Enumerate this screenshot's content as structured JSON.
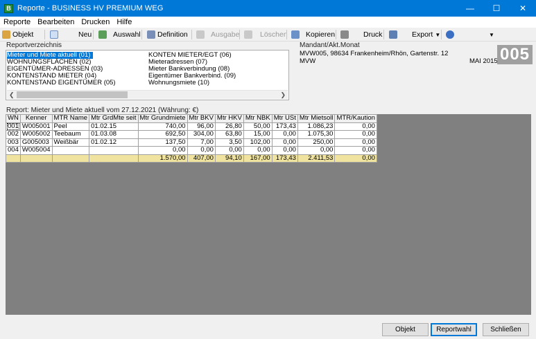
{
  "window": {
    "title": "Reporte - BUSINESS HV PREMIUM WEG",
    "app_icon_letter": "B",
    "controls": [
      "minimize-icon",
      "maximize-icon",
      "close-icon"
    ]
  },
  "menu": [
    "Reporte",
    "Bearbeiten",
    "Drucken",
    "Hilfe"
  ],
  "toolbar": {
    "objekt": "Objekt",
    "neu": "Neu",
    "auswahl": "Auswahl",
    "definition": "Definition",
    "ausgabe": "Ausgabe",
    "loeschen": "Löschen",
    "kopieren": "Kopieren",
    "druck": "Druck",
    "export": "Export"
  },
  "reportverzeichnis": {
    "label": "Reportverzeichnis",
    "left_items": [
      "Mieter und Miete aktuell (01)",
      "WOHNUNGSFLÄCHEN (02)",
      "EIGENTÜMER-ADRESSEN (03)",
      "KONTENSTAND MIETER (04)",
      "KONTENSTAND EIGENTÜMER (05)"
    ],
    "right_items": [
      "KONTEN MIETER/EGT (06)",
      "Mieteradressen (07)",
      "Mieter Bankverbindung (08)",
      "Eigentümer Bankverbind. (09)",
      "Wohnungsmiete (10)"
    ]
  },
  "mandant": {
    "label": "Mandant/Akt.Monat",
    "address": "MVW005, 98634 Frankenheim/Rhön, Gartenstr. 12",
    "code": "MVW",
    "month": "MAI 2015",
    "number": "005"
  },
  "report": {
    "caption": "Report: Mieter und Miete aktuell vom 27.12.2021 (Währung: €)",
    "columns": [
      "WN",
      "Kenner",
      "MTR Name",
      "Mtr GrdMte seit",
      "Mtr Grundmiete",
      "Mtr BKV",
      "Mtr HKV",
      "Mtr NBK",
      "Mtr USt",
      "Mtr Mietsoll",
      "MTR/Kaution"
    ],
    "rows": [
      [
        "001",
        "W005001",
        "Peel",
        "01.02.15",
        "740,00",
        "96,00",
        "26,80",
        "50,00",
        "173,43",
        "1.086,23",
        "0,00"
      ],
      [
        "002",
        "W005002",
        "Teebaum",
        "01.03.08",
        "692,50",
        "304,00",
        "63,80",
        "15,00",
        "0,00",
        "1.075,30",
        "0,00"
      ],
      [
        "003",
        "G005003",
        "Weißbär",
        "01.02.12",
        "137,50",
        "7,00",
        "3,50",
        "102,00",
        "0,00",
        "250,00",
        "0,00"
      ],
      [
        "004",
        "W005004",
        "",
        "",
        "0,00",
        "0,00",
        "0,00",
        "0,00",
        "0,00",
        "0,00",
        "0,00"
      ]
    ],
    "totals": [
      "",
      "",
      "",
      "",
      "1.570,00",
      "407,00",
      "94,10",
      "167,00",
      "173,43",
      "2.411,53",
      "0,00"
    ]
  },
  "buttons": {
    "objekt": "Objekt",
    "reportwahl": "Reportwahl",
    "schliessen": "Schließen"
  }
}
